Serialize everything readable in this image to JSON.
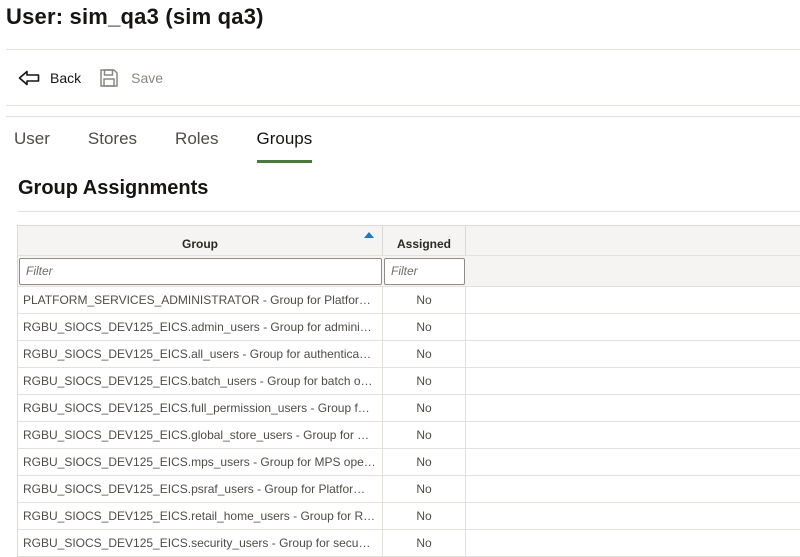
{
  "page": {
    "title": "User: sim_qa3 (sim qa3)"
  },
  "toolbar": {
    "back_label": "Back",
    "save_label": "Save"
  },
  "tabs": [
    {
      "label": "User",
      "active": false
    },
    {
      "label": "Stores",
      "active": false
    },
    {
      "label": "Roles",
      "active": false
    },
    {
      "label": "Groups",
      "active": true
    }
  ],
  "section": {
    "title": "Group Assignments"
  },
  "grid": {
    "columns": {
      "group": "Group",
      "assigned": "Assigned"
    },
    "sort": {
      "column": "group",
      "direction": "ascending"
    },
    "filters": {
      "group_placeholder": "Filter",
      "assigned_placeholder": "Filter"
    },
    "rows": [
      {
        "group": "PLATFORM_SERVICES_ADMINISTRATOR - Group for Platfor…",
        "assigned": "No"
      },
      {
        "group": "RGBU_SIOCS_DEV125_EICS.admin_users - Group for admini…",
        "assigned": "No"
      },
      {
        "group": "RGBU_SIOCS_DEV125_EICS.all_users - Group for authentica…",
        "assigned": "No"
      },
      {
        "group": "RGBU_SIOCS_DEV125_EICS.batch_users - Group for batch o…",
        "assigned": "No"
      },
      {
        "group": "RGBU_SIOCS_DEV125_EICS.full_permission_users - Group f…",
        "assigned": "No"
      },
      {
        "group": "RGBU_SIOCS_DEV125_EICS.global_store_users - Group for …",
        "assigned": "No"
      },
      {
        "group": "RGBU_SIOCS_DEV125_EICS.mps_users - Group for MPS ope…",
        "assigned": "No"
      },
      {
        "group": "RGBU_SIOCS_DEV125_EICS.psraf_users - Group for Platfor…",
        "assigned": "No"
      },
      {
        "group": "RGBU_SIOCS_DEV125_EICS.retail_home_users - Group for R…",
        "assigned": "No"
      },
      {
        "group": "RGBU_SIOCS_DEV125_EICS.security_users - Group for secu…",
        "assigned": "No"
      }
    ]
  },
  "icons": {
    "back": "back-arrow-icon",
    "save": "save-icon",
    "sort": "sort-ascending-icon"
  },
  "colors": {
    "tab_underline": "#4a7a3a",
    "sort_indicator": "#1e78c2"
  }
}
